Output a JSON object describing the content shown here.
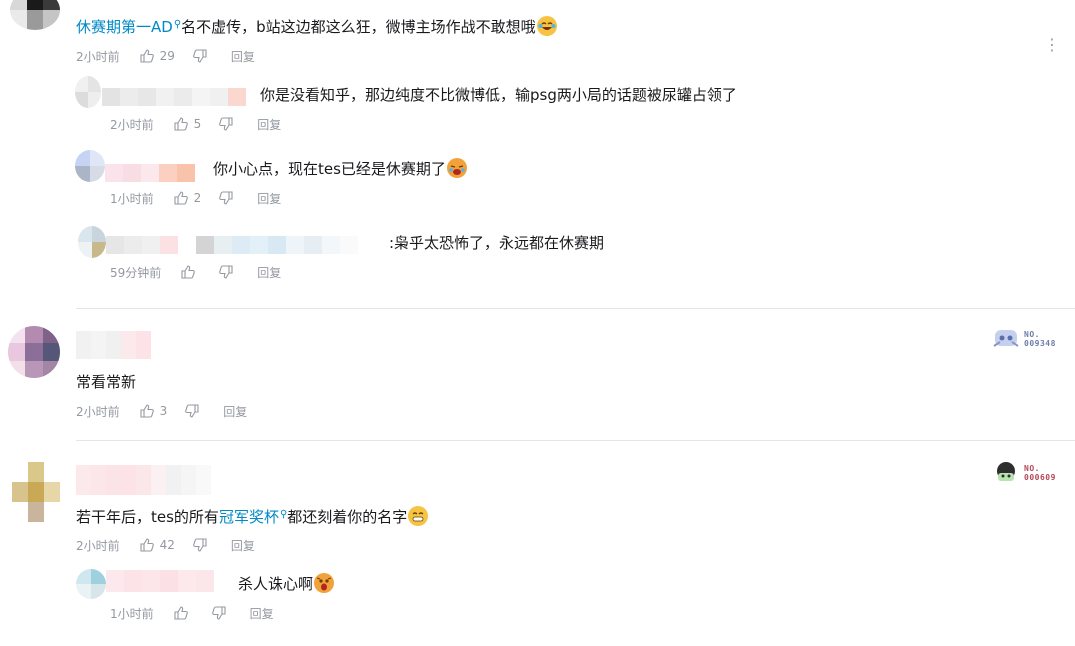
{
  "labels": {
    "reply": "回复"
  },
  "comments": [
    {
      "user": "休赛期第一AD",
      "text": "名不虚传，b站这边都这么狂，微博主场作战不敢想哦",
      "time": "2小时前",
      "likes": "29",
      "emoji": "laughing-tears-emoji",
      "replies": [
        {
          "text": "你是没看知乎，那边纯度不比微博低，输psg两小局的话题被尿罐占领了",
          "time": "2小时前",
          "likes": "5"
        },
        {
          "text": "你小心点，现在tes已经是休赛期了",
          "time": "1小时前",
          "likes": "2",
          "emoji": "crying-emoji"
        },
        {
          "text": ":枭乎太恐怖了，永远都在休赛期",
          "time": "59分钟前",
          "likes": ""
        }
      ]
    },
    {
      "text": "常看常新",
      "time": "2小时前",
      "likes": "3",
      "badge": "NO.\n009348"
    },
    {
      "text_before": "若干年后，tes的所有",
      "link": "冠军奖杯",
      "text_after": "都还刻着你的名字",
      "time": "2小时前",
      "likes": "42",
      "badge": "NO.\n000609",
      "emoji": "grin-emoji",
      "replies": [
        {
          "text": "杀人诛心啊",
          "time": "1小时前",
          "likes": "",
          "emoji": "shocked-emoji"
        }
      ]
    }
  ],
  "colors": {
    "link": "#008ac5",
    "meta": "#9499a0",
    "badge_num": "#6e7ea8",
    "badge_num_2": "#b5485a"
  }
}
